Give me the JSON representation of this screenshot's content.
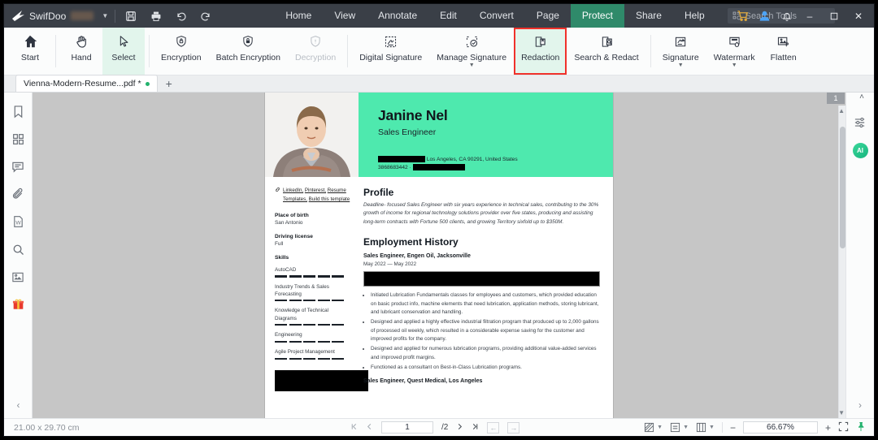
{
  "app": {
    "brand_name": "SwifDoo",
    "title_icons": [
      "save-icon",
      "print-icon",
      "undo-icon",
      "redo-icon"
    ],
    "menus": [
      {
        "label": "Home",
        "active": false
      },
      {
        "label": "View",
        "active": false
      },
      {
        "label": "Annotate",
        "active": false
      },
      {
        "label": "Edit",
        "active": false
      },
      {
        "label": "Convert",
        "active": false
      },
      {
        "label": "Page",
        "active": false
      },
      {
        "label": "Protect",
        "active": true
      },
      {
        "label": "Share",
        "active": false
      },
      {
        "label": "Help",
        "active": false
      }
    ],
    "search_placeholder": "Search Tools",
    "window_icons": [
      "cart-icon",
      "account-icon",
      "bell-icon"
    ],
    "window_buttons": {
      "minimize": "–",
      "maximize": "☐",
      "close": "✕"
    },
    "accent_green": "#2f8a6a",
    "highlight_red": "#f0312b"
  },
  "ribbon": {
    "groups": [
      {
        "items": [
          {
            "label": "Start",
            "icon": "home-icon",
            "state": "normal",
            "caret": false
          },
          {
            "label": "Hand",
            "icon": "hand-icon",
            "state": "normal",
            "caret": false
          },
          {
            "label": "Select",
            "icon": "cursor-icon",
            "state": "selected",
            "caret": false
          }
        ]
      },
      {
        "items": [
          {
            "label": "Encryption",
            "icon": "lock-shield-icon",
            "state": "normal",
            "caret": false
          },
          {
            "label": "Batch Encryption",
            "icon": "padlock-icon",
            "state": "normal",
            "caret": false
          },
          {
            "label": "Decryption",
            "icon": "unlock-shield-icon",
            "state": "disabled",
            "caret": false
          }
        ]
      },
      {
        "items": [
          {
            "label": "Digital Signature",
            "icon": "digital-signature-icon",
            "state": "normal",
            "caret": false
          },
          {
            "label": "Manage Signature",
            "icon": "manage-signature-icon",
            "state": "normal",
            "caret": true
          },
          {
            "label": "Redaction",
            "icon": "redaction-icon",
            "state": "highlighted",
            "caret": false
          },
          {
            "label": "Search & Redact",
            "icon": "search-redact-icon",
            "state": "normal",
            "caret": false
          }
        ]
      },
      {
        "items": [
          {
            "label": "Signature",
            "icon": "signature-icon",
            "state": "normal",
            "caret": true
          },
          {
            "label": "Watermark",
            "icon": "watermark-icon",
            "state": "normal",
            "caret": true
          },
          {
            "label": "Flatten",
            "icon": "flatten-icon",
            "state": "normal",
            "caret": false
          }
        ]
      }
    ]
  },
  "tabs": {
    "documents": [
      {
        "label": "Vienna-Modern-Resume...pdf *",
        "modified": true
      }
    ],
    "new_tab_label": "+"
  },
  "left_sidebar": {
    "items": [
      {
        "name": "bookmark-icon",
        "label": "Bookmark"
      },
      {
        "name": "thumbnails-icon",
        "label": "Thumbnails"
      },
      {
        "name": "comment-icon",
        "label": "Comments"
      },
      {
        "name": "attachment-icon",
        "label": "Attachments"
      },
      {
        "name": "word-icon",
        "label": "Word"
      },
      {
        "name": "search-icon",
        "label": "Search"
      },
      {
        "name": "stamp-icon",
        "label": "Stamp"
      },
      {
        "name": "gift-icon",
        "label": "Gift"
      }
    ],
    "collapse_label": "‹"
  },
  "right_rail": {
    "page_badge": "1",
    "collapse_caret": "˄",
    "settings_icon": "sliders-icon",
    "ai_label": "AI",
    "expand_label": "›"
  },
  "document": {
    "name": "Janine Nel",
    "role": "Sales Engineer",
    "contact_city": "Los Angeles, CA 90291, United States",
    "contact_phone": "3868683442",
    "contact_separator": "·",
    "links": [
      "LinkedIn,",
      "Pinterest,",
      "Resume Templates,",
      "Build this template"
    ],
    "place_of_birth_label": "Place of birth",
    "place_of_birth": "San Antonio",
    "driving_license_label": "Driving license",
    "driving_license": "Full",
    "skills_label": "Skills",
    "skills": [
      {
        "name": "AutoCAD",
        "rating": 5
      },
      {
        "name": "Industry Trends & Sales Forecasting",
        "rating": 5
      },
      {
        "name": "Knowledge of Technical Diagrams",
        "rating": 5
      },
      {
        "name": "Engineering",
        "rating": 5
      },
      {
        "name": "Agile Project Management",
        "rating": 5
      }
    ],
    "profile_heading": "Profile",
    "profile_text": "Deadline- focused Sales Engineer with six years experience in technical sales, contributing to the 30% growth of income for regional technology solutions provider over five states, producing and assisting long-term contracts with Fortune 500 clients, and growing Territory sixfold up to $350M.",
    "employment_heading": "Employment History",
    "job1_title": "Sales Engineer, Engen Oil, Jacksonville",
    "job1_dates": "May 2022 — May 2022",
    "job1_bullets": [
      "Initiated Lubrication Fundamentals classes for employees and customers, which provided education on basic product info, machine elements that need lubrication, application methods, storing lubricant, and lubricant conservation and handling.",
      "Designed and applied a highly effective industrial filtration program that produced up to 2,000 gallons of processed oil weekly, which resulted in a considerable expense saving for the customer and improved profits for the company.",
      "Designed and applied for numerous lubrication programs, providing additional value-added services and improved profit margins.",
      "Functioned as a consultant on Best-in-Class Lubrication programs."
    ],
    "job2_title": "Sales Engineer, Quest Medical, Los Angeles"
  },
  "status_bar": {
    "dimensions": "21.00 x 29.70 cm",
    "nav": {
      "first": "«",
      "prev": "‹",
      "page_value": "1",
      "total": "/2",
      "next": "›",
      "last": "»",
      "back": "←",
      "forward": "→"
    },
    "view_modes": [
      "grid-view-icon",
      "single-page-icon",
      "two-page-icon"
    ],
    "zoom_out": "−",
    "zoom_value": "66.67%",
    "zoom_in": "+",
    "fullscreen_icon": "fullscreen-icon",
    "pin_icon": "pin-icon"
  }
}
